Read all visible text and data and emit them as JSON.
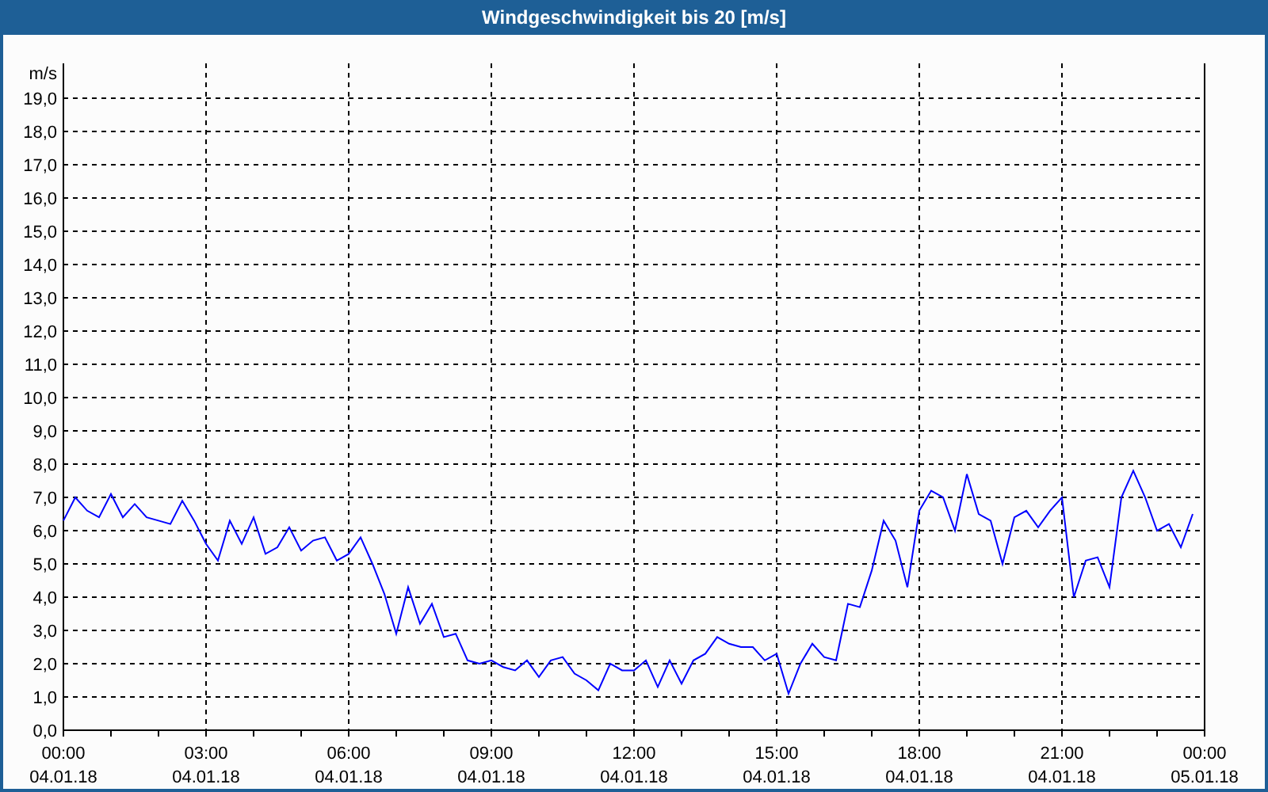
{
  "window": {
    "title": "Windgeschwindigkeit bis 20 [m/s]"
  },
  "chart_data": {
    "type": "line",
    "ylabel": "m/s",
    "categories": [
      "00:00 04.01.18",
      null,
      null,
      null,
      null,
      null,
      null,
      null,
      null,
      null,
      null,
      null,
      "03:00 04.01.18",
      null,
      null,
      null,
      null,
      null,
      null,
      null,
      null,
      null,
      null,
      null,
      "06:00 04.01.18",
      null,
      null,
      null,
      null,
      null,
      null,
      null,
      null,
      null,
      null,
      null,
      "09:00 04.01.18",
      null,
      null,
      null,
      null,
      null,
      null,
      null,
      null,
      null,
      null,
      null,
      "12:00 04.01.18",
      null,
      null,
      null,
      null,
      null,
      null,
      null,
      null,
      null,
      null,
      null,
      "15:00 04.01.18",
      null,
      null,
      null,
      null,
      null,
      null,
      null,
      null,
      null,
      null,
      null,
      "18:00 04.01.18",
      null,
      null,
      null,
      null,
      null,
      null,
      null,
      null,
      null,
      null,
      null,
      "21:00 04.01.18",
      null,
      null,
      null,
      null,
      null,
      null,
      null,
      null,
      null,
      null,
      null,
      "00:00 05.01.18"
    ],
    "values": [
      6.3,
      7.0,
      6.6,
      6.4,
      7.1,
      6.4,
      6.8,
      6.4,
      6.3,
      6.2,
      6.9,
      6.3,
      5.6,
      5.1,
      6.3,
      5.6,
      6.4,
      5.3,
      5.5,
      6.1,
      5.4,
      5.7,
      5.8,
      5.1,
      5.3,
      5.8,
      5.0,
      4.1,
      2.9,
      4.3,
      3.2,
      3.8,
      2.8,
      2.9,
      2.1,
      2.0,
      2.1,
      1.9,
      1.8,
      2.1,
      1.6,
      2.1,
      2.2,
      1.7,
      1.5,
      1.2,
      2.0,
      1.8,
      1.8,
      2.1,
      1.3,
      2.1,
      1.4,
      2.1,
      2.3,
      2.8,
      2.6,
      2.5,
      2.5,
      2.1,
      2.3,
      1.1,
      2.0,
      2.6,
      2.2,
      2.1,
      3.8,
      3.7,
      4.8,
      6.3,
      5.7,
      4.3,
      6.6,
      7.2,
      7.0,
      6.0,
      7.7,
      6.5,
      6.3,
      5.0,
      6.4,
      6.6,
      6.1,
      6.6,
      7.0,
      4.0,
      5.1,
      5.2,
      4.3,
      7.0,
      7.8,
      7.0,
      6.0,
      6.2,
      5.5,
      6.5,
      null
    ],
    "ylim": [
      0,
      19
    ],
    "grid": true,
    "yticks": [
      {
        "value": 0,
        "label": "0,0"
      },
      {
        "value": 1,
        "label": "1,0"
      },
      {
        "value": 2,
        "label": "2,0"
      },
      {
        "value": 3,
        "label": "3,0"
      },
      {
        "value": 4,
        "label": "4,0"
      },
      {
        "value": 5,
        "label": "5,0"
      },
      {
        "value": 6,
        "label": "6,0"
      },
      {
        "value": 7,
        "label": "7,0"
      },
      {
        "value": 8,
        "label": "8,0"
      },
      {
        "value": 9,
        "label": "9,0"
      },
      {
        "value": 10,
        "label": "10,0"
      },
      {
        "value": 11,
        "label": "11,0"
      },
      {
        "value": 12,
        "label": "12,0"
      },
      {
        "value": 13,
        "label": "13,0"
      },
      {
        "value": 14,
        "label": "14,0"
      },
      {
        "value": 15,
        "label": "15,0"
      },
      {
        "value": 16,
        "label": "16,0"
      },
      {
        "value": 17,
        "label": "17,0"
      },
      {
        "value": 18,
        "label": "18,0"
      },
      {
        "value": 19,
        "label": "19,0"
      }
    ]
  }
}
